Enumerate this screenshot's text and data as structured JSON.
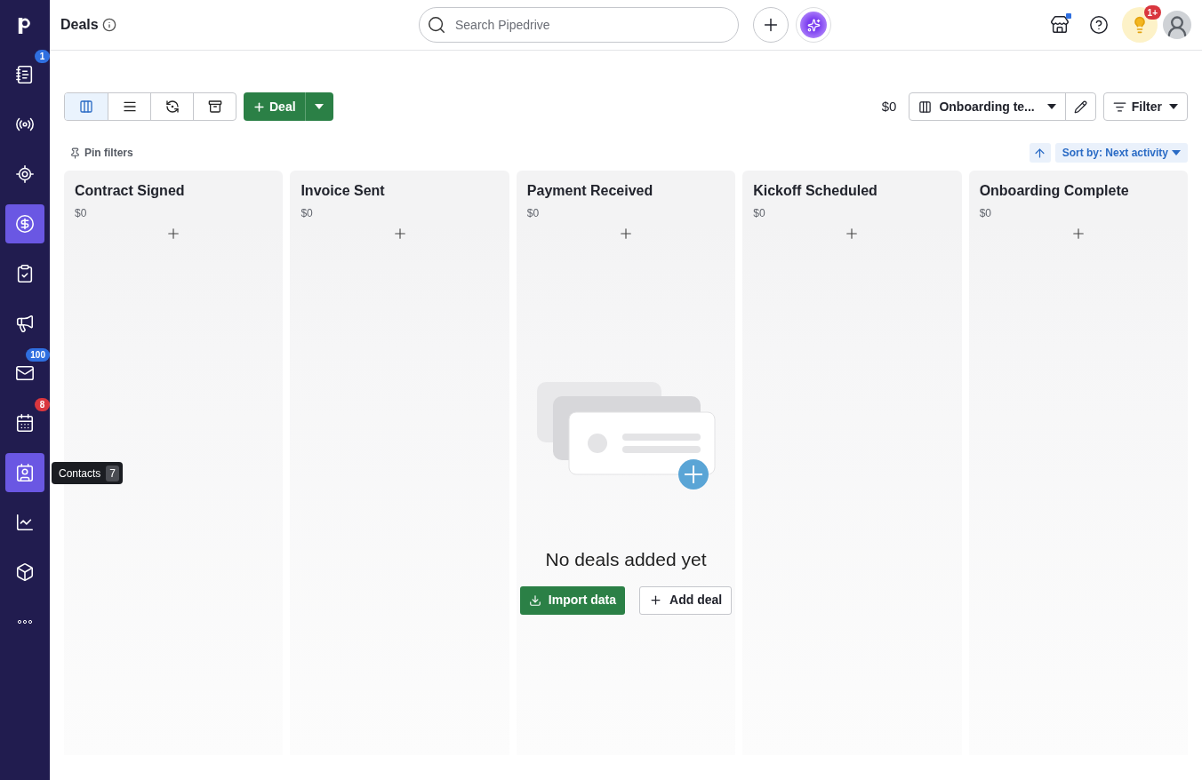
{
  "sidebar": {
    "items": [
      {
        "active": false,
        "badge": {
          "text": "1",
          "color": "#2f6fe0"
        }
      },
      {
        "active": false
      },
      {
        "active": false
      },
      {
        "active": true
      },
      {
        "active": false
      },
      {
        "active": false
      },
      {
        "active": false,
        "badge": {
          "text": "100",
          "color": "#2f6fe0"
        }
      },
      {
        "active": false,
        "badge": {
          "text": "8",
          "color": "#d9363e"
        }
      },
      {
        "active": true,
        "tooltip": {
          "label": "Contacts",
          "shortcut": "7"
        }
      },
      {
        "active": false
      },
      {
        "active": false
      },
      {
        "active": false
      }
    ]
  },
  "header": {
    "title": "Deals",
    "search": {
      "placeholder": "Search Pipedrive"
    },
    "notification_badge": "1+"
  },
  "toolbar": {
    "views": [
      {
        "selected": true
      },
      {
        "selected": false
      },
      {
        "selected": false
      },
      {
        "selected": false
      }
    ],
    "add_button": "Deal",
    "total": "$0",
    "pipeline": "Onboarding te...",
    "filter": "Filter",
    "pin_filters": "Pin filters",
    "sort": "Sort by: Next activity"
  },
  "stages": [
    {
      "name": "Contract Signed",
      "amount": "$0"
    },
    {
      "name": "Invoice Sent",
      "amount": "$0"
    },
    {
      "name": "Payment Received",
      "amount": "$0"
    },
    {
      "name": "Kickoff Scheduled",
      "amount": "$0"
    },
    {
      "name": "Onboarding Complete",
      "amount": "$0"
    }
  ],
  "empty_state": {
    "message": "No deals added yet",
    "import_button": "Import data",
    "add_button": "Add deal"
  }
}
